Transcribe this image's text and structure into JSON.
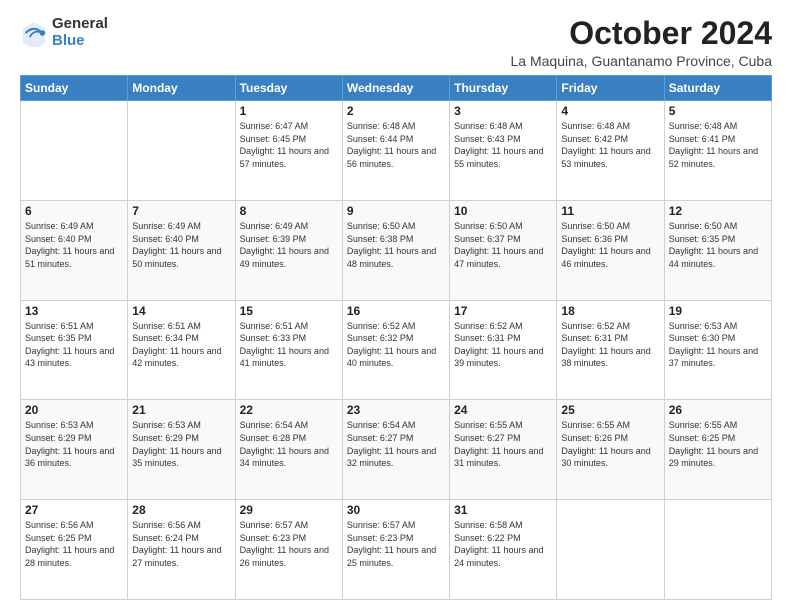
{
  "logo": {
    "general": "General",
    "blue": "Blue"
  },
  "title": {
    "month_year": "October 2024",
    "location": "La Maquina, Guantanamo Province, Cuba"
  },
  "days_of_week": [
    "Sunday",
    "Monday",
    "Tuesday",
    "Wednesday",
    "Thursday",
    "Friday",
    "Saturday"
  ],
  "weeks": [
    [
      {
        "day": "",
        "info": ""
      },
      {
        "day": "",
        "info": ""
      },
      {
        "day": "1",
        "info": "Sunrise: 6:47 AM\nSunset: 6:45 PM\nDaylight: 11 hours and 57 minutes."
      },
      {
        "day": "2",
        "info": "Sunrise: 6:48 AM\nSunset: 6:44 PM\nDaylight: 11 hours and 56 minutes."
      },
      {
        "day": "3",
        "info": "Sunrise: 6:48 AM\nSunset: 6:43 PM\nDaylight: 11 hours and 55 minutes."
      },
      {
        "day": "4",
        "info": "Sunrise: 6:48 AM\nSunset: 6:42 PM\nDaylight: 11 hours and 53 minutes."
      },
      {
        "day": "5",
        "info": "Sunrise: 6:48 AM\nSunset: 6:41 PM\nDaylight: 11 hours and 52 minutes."
      }
    ],
    [
      {
        "day": "6",
        "info": "Sunrise: 6:49 AM\nSunset: 6:40 PM\nDaylight: 11 hours and 51 minutes."
      },
      {
        "day": "7",
        "info": "Sunrise: 6:49 AM\nSunset: 6:40 PM\nDaylight: 11 hours and 50 minutes."
      },
      {
        "day": "8",
        "info": "Sunrise: 6:49 AM\nSunset: 6:39 PM\nDaylight: 11 hours and 49 minutes."
      },
      {
        "day": "9",
        "info": "Sunrise: 6:50 AM\nSunset: 6:38 PM\nDaylight: 11 hours and 48 minutes."
      },
      {
        "day": "10",
        "info": "Sunrise: 6:50 AM\nSunset: 6:37 PM\nDaylight: 11 hours and 47 minutes."
      },
      {
        "day": "11",
        "info": "Sunrise: 6:50 AM\nSunset: 6:36 PM\nDaylight: 11 hours and 46 minutes."
      },
      {
        "day": "12",
        "info": "Sunrise: 6:50 AM\nSunset: 6:35 PM\nDaylight: 11 hours and 44 minutes."
      }
    ],
    [
      {
        "day": "13",
        "info": "Sunrise: 6:51 AM\nSunset: 6:35 PM\nDaylight: 11 hours and 43 minutes."
      },
      {
        "day": "14",
        "info": "Sunrise: 6:51 AM\nSunset: 6:34 PM\nDaylight: 11 hours and 42 minutes."
      },
      {
        "day": "15",
        "info": "Sunrise: 6:51 AM\nSunset: 6:33 PM\nDaylight: 11 hours and 41 minutes."
      },
      {
        "day": "16",
        "info": "Sunrise: 6:52 AM\nSunset: 6:32 PM\nDaylight: 11 hours and 40 minutes."
      },
      {
        "day": "17",
        "info": "Sunrise: 6:52 AM\nSunset: 6:31 PM\nDaylight: 11 hours and 39 minutes."
      },
      {
        "day": "18",
        "info": "Sunrise: 6:52 AM\nSunset: 6:31 PM\nDaylight: 11 hours and 38 minutes."
      },
      {
        "day": "19",
        "info": "Sunrise: 6:53 AM\nSunset: 6:30 PM\nDaylight: 11 hours and 37 minutes."
      }
    ],
    [
      {
        "day": "20",
        "info": "Sunrise: 6:53 AM\nSunset: 6:29 PM\nDaylight: 11 hours and 36 minutes."
      },
      {
        "day": "21",
        "info": "Sunrise: 6:53 AM\nSunset: 6:29 PM\nDaylight: 11 hours and 35 minutes."
      },
      {
        "day": "22",
        "info": "Sunrise: 6:54 AM\nSunset: 6:28 PM\nDaylight: 11 hours and 34 minutes."
      },
      {
        "day": "23",
        "info": "Sunrise: 6:54 AM\nSunset: 6:27 PM\nDaylight: 11 hours and 32 minutes."
      },
      {
        "day": "24",
        "info": "Sunrise: 6:55 AM\nSunset: 6:27 PM\nDaylight: 11 hours and 31 minutes."
      },
      {
        "day": "25",
        "info": "Sunrise: 6:55 AM\nSunset: 6:26 PM\nDaylight: 11 hours and 30 minutes."
      },
      {
        "day": "26",
        "info": "Sunrise: 6:55 AM\nSunset: 6:25 PM\nDaylight: 11 hours and 29 minutes."
      }
    ],
    [
      {
        "day": "27",
        "info": "Sunrise: 6:56 AM\nSunset: 6:25 PM\nDaylight: 11 hours and 28 minutes."
      },
      {
        "day": "28",
        "info": "Sunrise: 6:56 AM\nSunset: 6:24 PM\nDaylight: 11 hours and 27 minutes."
      },
      {
        "day": "29",
        "info": "Sunrise: 6:57 AM\nSunset: 6:23 PM\nDaylight: 11 hours and 26 minutes."
      },
      {
        "day": "30",
        "info": "Sunrise: 6:57 AM\nSunset: 6:23 PM\nDaylight: 11 hours and 25 minutes."
      },
      {
        "day": "31",
        "info": "Sunrise: 6:58 AM\nSunset: 6:22 PM\nDaylight: 11 hours and 24 minutes."
      },
      {
        "day": "",
        "info": ""
      },
      {
        "day": "",
        "info": ""
      }
    ]
  ]
}
